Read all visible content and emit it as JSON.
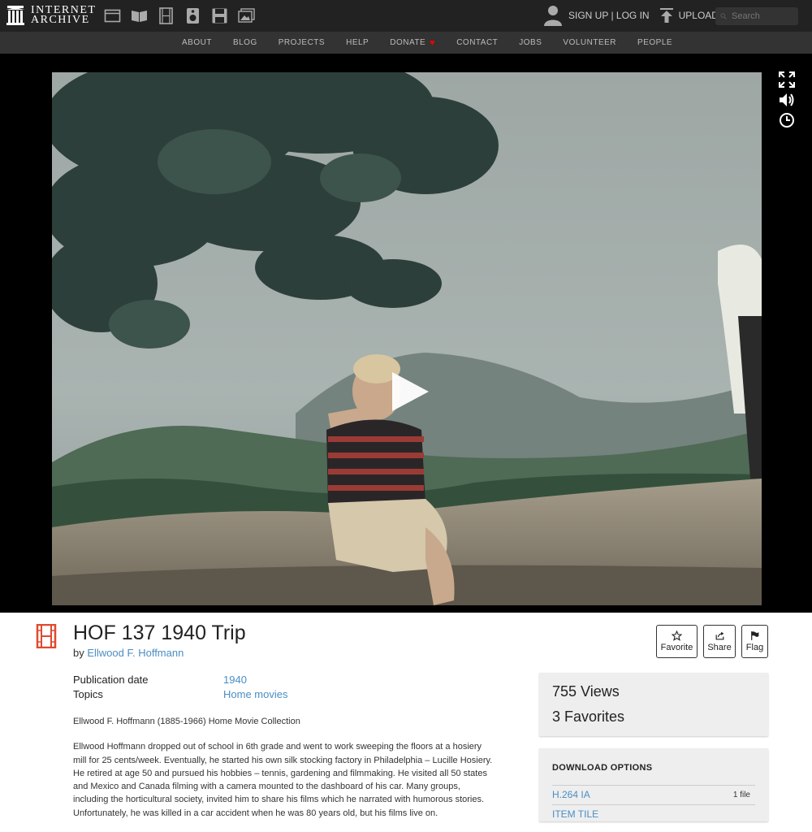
{
  "topbar": {
    "logo_line1": "INTERNET",
    "logo_line2": "ARCHIVE",
    "sign_up": "SIGN UP",
    "separator": " | ",
    "log_in": "LOG IN",
    "upload": "UPLOAD",
    "search_placeholder": "Search"
  },
  "nav": {
    "items": [
      "ABOUT",
      "BLOG",
      "PROJECTS",
      "HELP",
      "DONATE",
      "CONTACT",
      "JOBS",
      "VOLUNTEER",
      "PEOPLE"
    ]
  },
  "item": {
    "title": "HOF 137 1940 Trip",
    "by_prefix": "by ",
    "author": "Ellwood F. Hoffmann",
    "actions": {
      "favorite": "Favorite",
      "share": "Share",
      "flag": "Flag"
    },
    "metadata": [
      {
        "key": "Publication date",
        "value": "1940"
      },
      {
        "key": "Topics",
        "value": "Home movies"
      }
    ],
    "description": [
      "Ellwood F. Hoffmann (1885-1966) Home Movie Collection",
      "Ellwood Hoffmann dropped out of school in 6th grade and went to work sweeping the floors at a hosiery mill for 25 cents/week. Eventually, he started his own silk stocking factory in Philadelphia – Lucille Hosiery. He retired at age 50 and pursued his hobbies – tennis, gardening and filmmaking. He visited all 50 states and Mexico and Canada filming with a camera mounted to the dashboard of his car. Many groups, including the horticultural society, invited him to share his films which he narrated with humorous stories. Unfortunately, he was killed in a car accident when he was 80 years old, but his films live on."
    ]
  },
  "stats": {
    "views": "755 Views",
    "favorites": "3 Favorites"
  },
  "downloads": {
    "title": "DOWNLOAD OPTIONS",
    "options": [
      {
        "label": "H.264 IA",
        "count": "1 file"
      },
      {
        "label": "ITEM TILE",
        "count": ""
      }
    ]
  },
  "colors": {
    "topbar": "#222222",
    "navbar": "#333333",
    "link": "#4a8ec4",
    "film_icon": "#e04a2f",
    "heart": "#ee0000"
  }
}
